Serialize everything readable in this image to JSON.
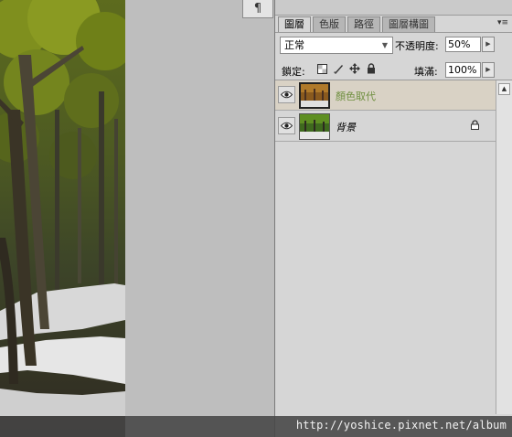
{
  "toolbar_fragment": {
    "paragraph_symbol": "¶"
  },
  "panel": {
    "tabs": [
      {
        "label": "圖層",
        "active": true
      },
      {
        "label": "色版",
        "active": false
      },
      {
        "label": "路徑",
        "active": false
      },
      {
        "label": "圖層構圖",
        "active": false
      }
    ],
    "menu_glyph": "▾≡",
    "blend_mode": "正常",
    "opacity_label": "不透明度:",
    "opacity_value": "50%",
    "lock_label": "鎖定:",
    "fill_label": "填滿:",
    "fill_value": "100%",
    "lock_icons": [
      "lock-transparent-pixels-icon",
      "lock-image-pixels-icon",
      "lock-position-icon",
      "lock-all-icon"
    ]
  },
  "layers": [
    {
      "name": "顏色取代",
      "selected": true,
      "visible": true,
      "locked": false
    },
    {
      "name": "背景",
      "selected": false,
      "visible": true,
      "locked": true
    }
  ],
  "watermark": "http://yoshice.pixnet.net/album",
  "colors": {
    "selected_layer_bg": "#d9d2c5",
    "selected_layer_text": "#6f8f3f",
    "panel_bg": "#d6d6d6",
    "workspace_bg": "#bebebe"
  }
}
